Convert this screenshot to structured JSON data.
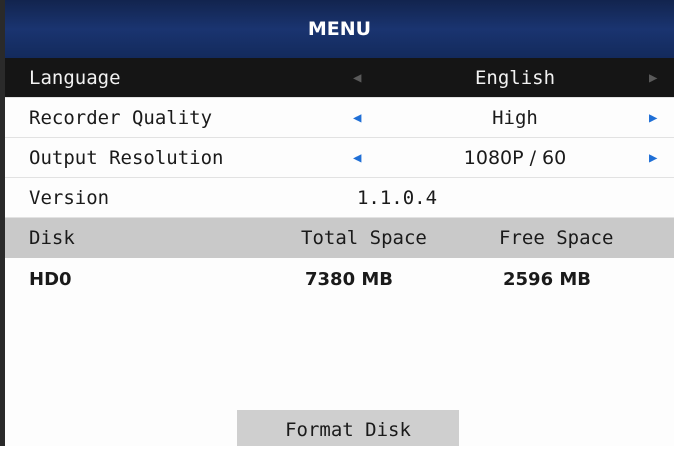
{
  "menu": {
    "title": "MENU"
  },
  "settings": [
    {
      "label": "Language",
      "value": "English"
    },
    {
      "label": "Recorder Quality",
      "value": "High"
    },
    {
      "label": "Output Resolution",
      "value": "1080P / 60"
    },
    {
      "label": "Version",
      "value": "1.1.0.4"
    }
  ],
  "arrows": {
    "left": "◀",
    "right": "▶"
  },
  "disk": {
    "headers": [
      "Disk",
      "Total Space",
      "Free Space"
    ],
    "rows": [
      {
        "name": "HD0",
        "total": "7380 MB",
        "free": "2596 MB"
      }
    ]
  },
  "actions": {
    "format_label": "Format Disk"
  },
  "colors": {
    "header_bg": "#1a3470",
    "selected_row_bg": "#151515",
    "arrow_active": "#1f6fd6",
    "disk_header_bg": "#c9c9c9",
    "button_bg": "#cfcfcf"
  }
}
